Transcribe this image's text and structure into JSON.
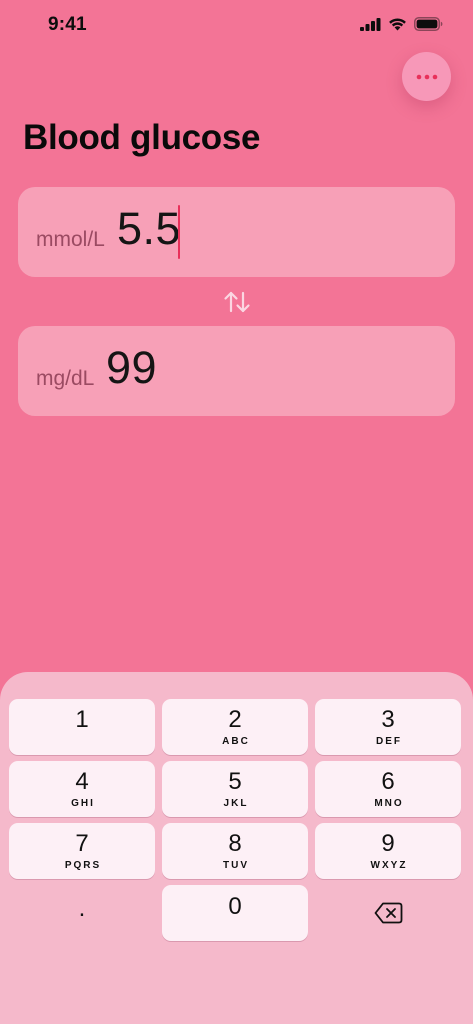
{
  "status_bar": {
    "time": "9:41",
    "icons": [
      "cellular-signal-icon",
      "wifi-icon",
      "battery-icon"
    ]
  },
  "header": {
    "title": "Blood glucose",
    "more_button_icon": "ellipsis-icon"
  },
  "converter": {
    "input": {
      "unit": "mmol/L",
      "value": "5.5"
    },
    "swap_icon": "swap-arrows-icon",
    "output": {
      "unit": "mg/dL",
      "value": "99"
    }
  },
  "keypad": {
    "keys": [
      {
        "digit": "1",
        "letters": ""
      },
      {
        "digit": "2",
        "letters": "ABC"
      },
      {
        "digit": "3",
        "letters": "DEF"
      },
      {
        "digit": "4",
        "letters": "GHI"
      },
      {
        "digit": "5",
        "letters": "JKL"
      },
      {
        "digit": "6",
        "letters": "MNO"
      },
      {
        "digit": "7",
        "letters": "PQRS"
      },
      {
        "digit": "8",
        "letters": "TUV"
      },
      {
        "digit": "9",
        "letters": "WXYZ"
      }
    ],
    "decimal": ".",
    "zero": "0",
    "delete_icon": "backspace-icon"
  },
  "colors": {
    "background": "#f37496",
    "accent": "#e8305a",
    "keypad_background": "#f5b9cb",
    "key_background": "#fdf0f6"
  }
}
